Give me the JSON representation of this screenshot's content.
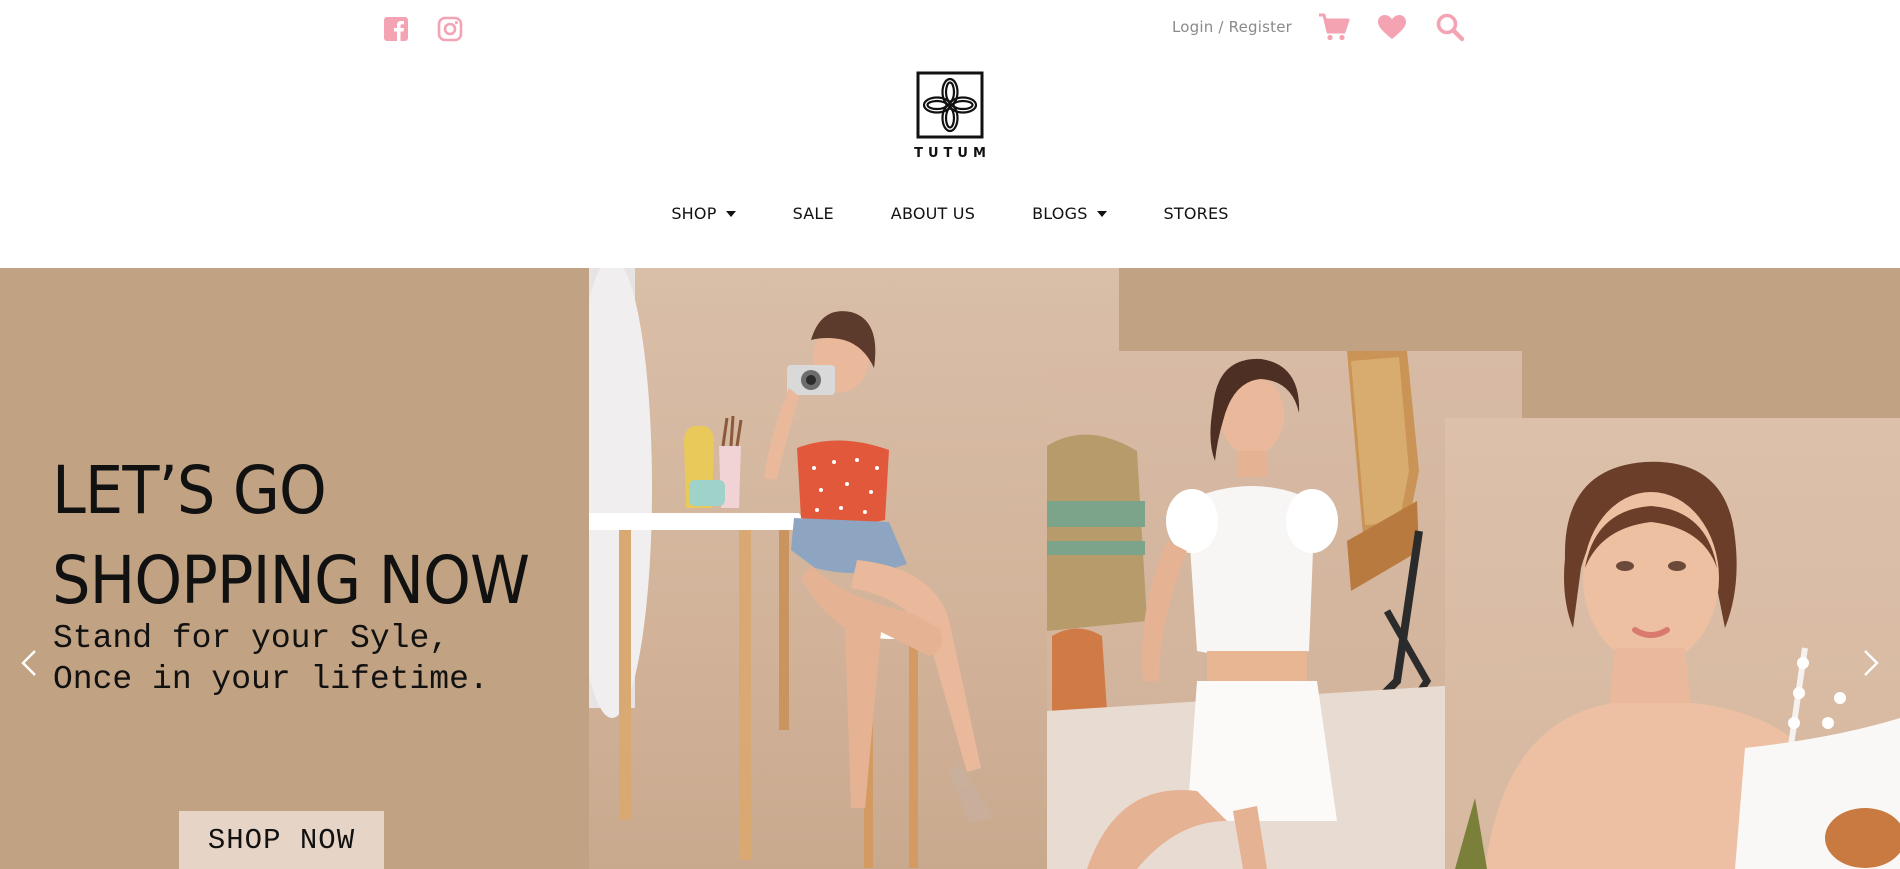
{
  "colors": {
    "accent_pink": "#f4a3b2",
    "hero_background": "#c1a283",
    "cta_background": "#e6d5c6",
    "text_dark": "#111111",
    "text_muted": "#8a8a8a"
  },
  "header": {
    "social_icons": [
      "facebook-icon",
      "instagram-icon"
    ],
    "login_label": "Login",
    "separator": " / ",
    "register_label": "Register",
    "action_icons": [
      "cart-icon",
      "heart-icon",
      "search-icon"
    ],
    "brand_name": "TUTUM"
  },
  "nav": {
    "items": [
      {
        "label": "SHOP",
        "has_dropdown": true
      },
      {
        "label": "SALE",
        "has_dropdown": false
      },
      {
        "label": "ABOUT US",
        "has_dropdown": false
      },
      {
        "label": "BLOGS",
        "has_dropdown": true
      },
      {
        "label": "STORES",
        "has_dropdown": false
      }
    ]
  },
  "hero": {
    "headline_line1": "LET’S GO",
    "headline_line2": "SHOPPING NOW",
    "tagline_line1": "Stand for your Syle,",
    "tagline_line2": "Once in your lifetime.",
    "cta_label": "SHOP NOW",
    "prev_icon": "chevron-left-icon",
    "next_icon": "chevron-right-icon"
  }
}
